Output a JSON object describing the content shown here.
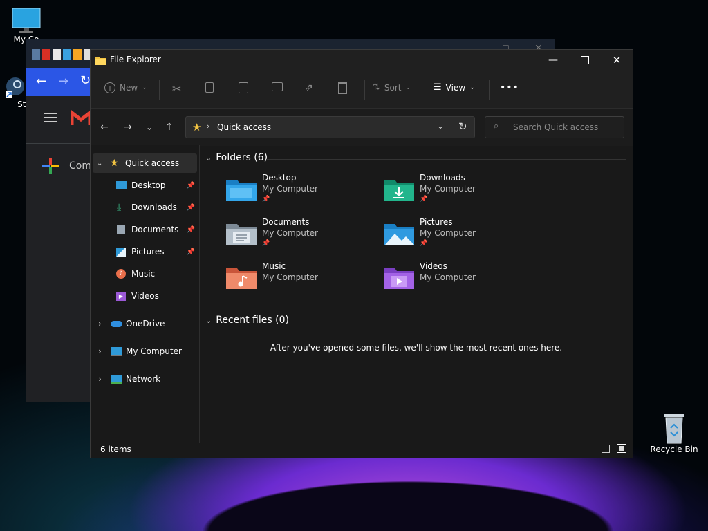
{
  "desktop": {
    "my_computer_label": "My Co",
    "steam_label": "Ste",
    "recycle_bin_label": "Recycle Bin"
  },
  "browser_bg": {
    "compose_label": "Com"
  },
  "explorer": {
    "title": "File Explorer",
    "toolbar": {
      "new_label": "New",
      "sort_label": "Sort",
      "view_label": "View",
      "more_label": "•••"
    },
    "address": {
      "location": "Quick access"
    },
    "search": {
      "placeholder": "Search Quick access"
    },
    "sidebar": {
      "quick_access": "Quick access",
      "items": [
        {
          "label": "Desktop",
          "pinned": true
        },
        {
          "label": "Downloads",
          "pinned": true
        },
        {
          "label": "Documents",
          "pinned": true
        },
        {
          "label": "Pictures",
          "pinned": true
        },
        {
          "label": "Music",
          "pinned": false
        },
        {
          "label": "Videos",
          "pinned": false
        }
      ],
      "onedrive": "OneDrive",
      "my_computer": "My Computer",
      "network": "Network"
    },
    "folders_header": "Folders (6)",
    "folders": [
      {
        "name": "Desktop",
        "location": "My Computer",
        "pinned": true
      },
      {
        "name": "Downloads",
        "location": "My Computer",
        "pinned": true
      },
      {
        "name": "Documents",
        "location": "My Computer",
        "pinned": true
      },
      {
        "name": "Pictures",
        "location": "My Computer",
        "pinned": true
      },
      {
        "name": "Music",
        "location": "My Computer",
        "pinned": false
      },
      {
        "name": "Videos",
        "location": "My Computer",
        "pinned": false
      }
    ],
    "recent_header": "Recent files (0)",
    "recent_empty": "After you've opened some files, we'll show the most recent ones here.",
    "status": {
      "item_count": "6 items"
    }
  }
}
